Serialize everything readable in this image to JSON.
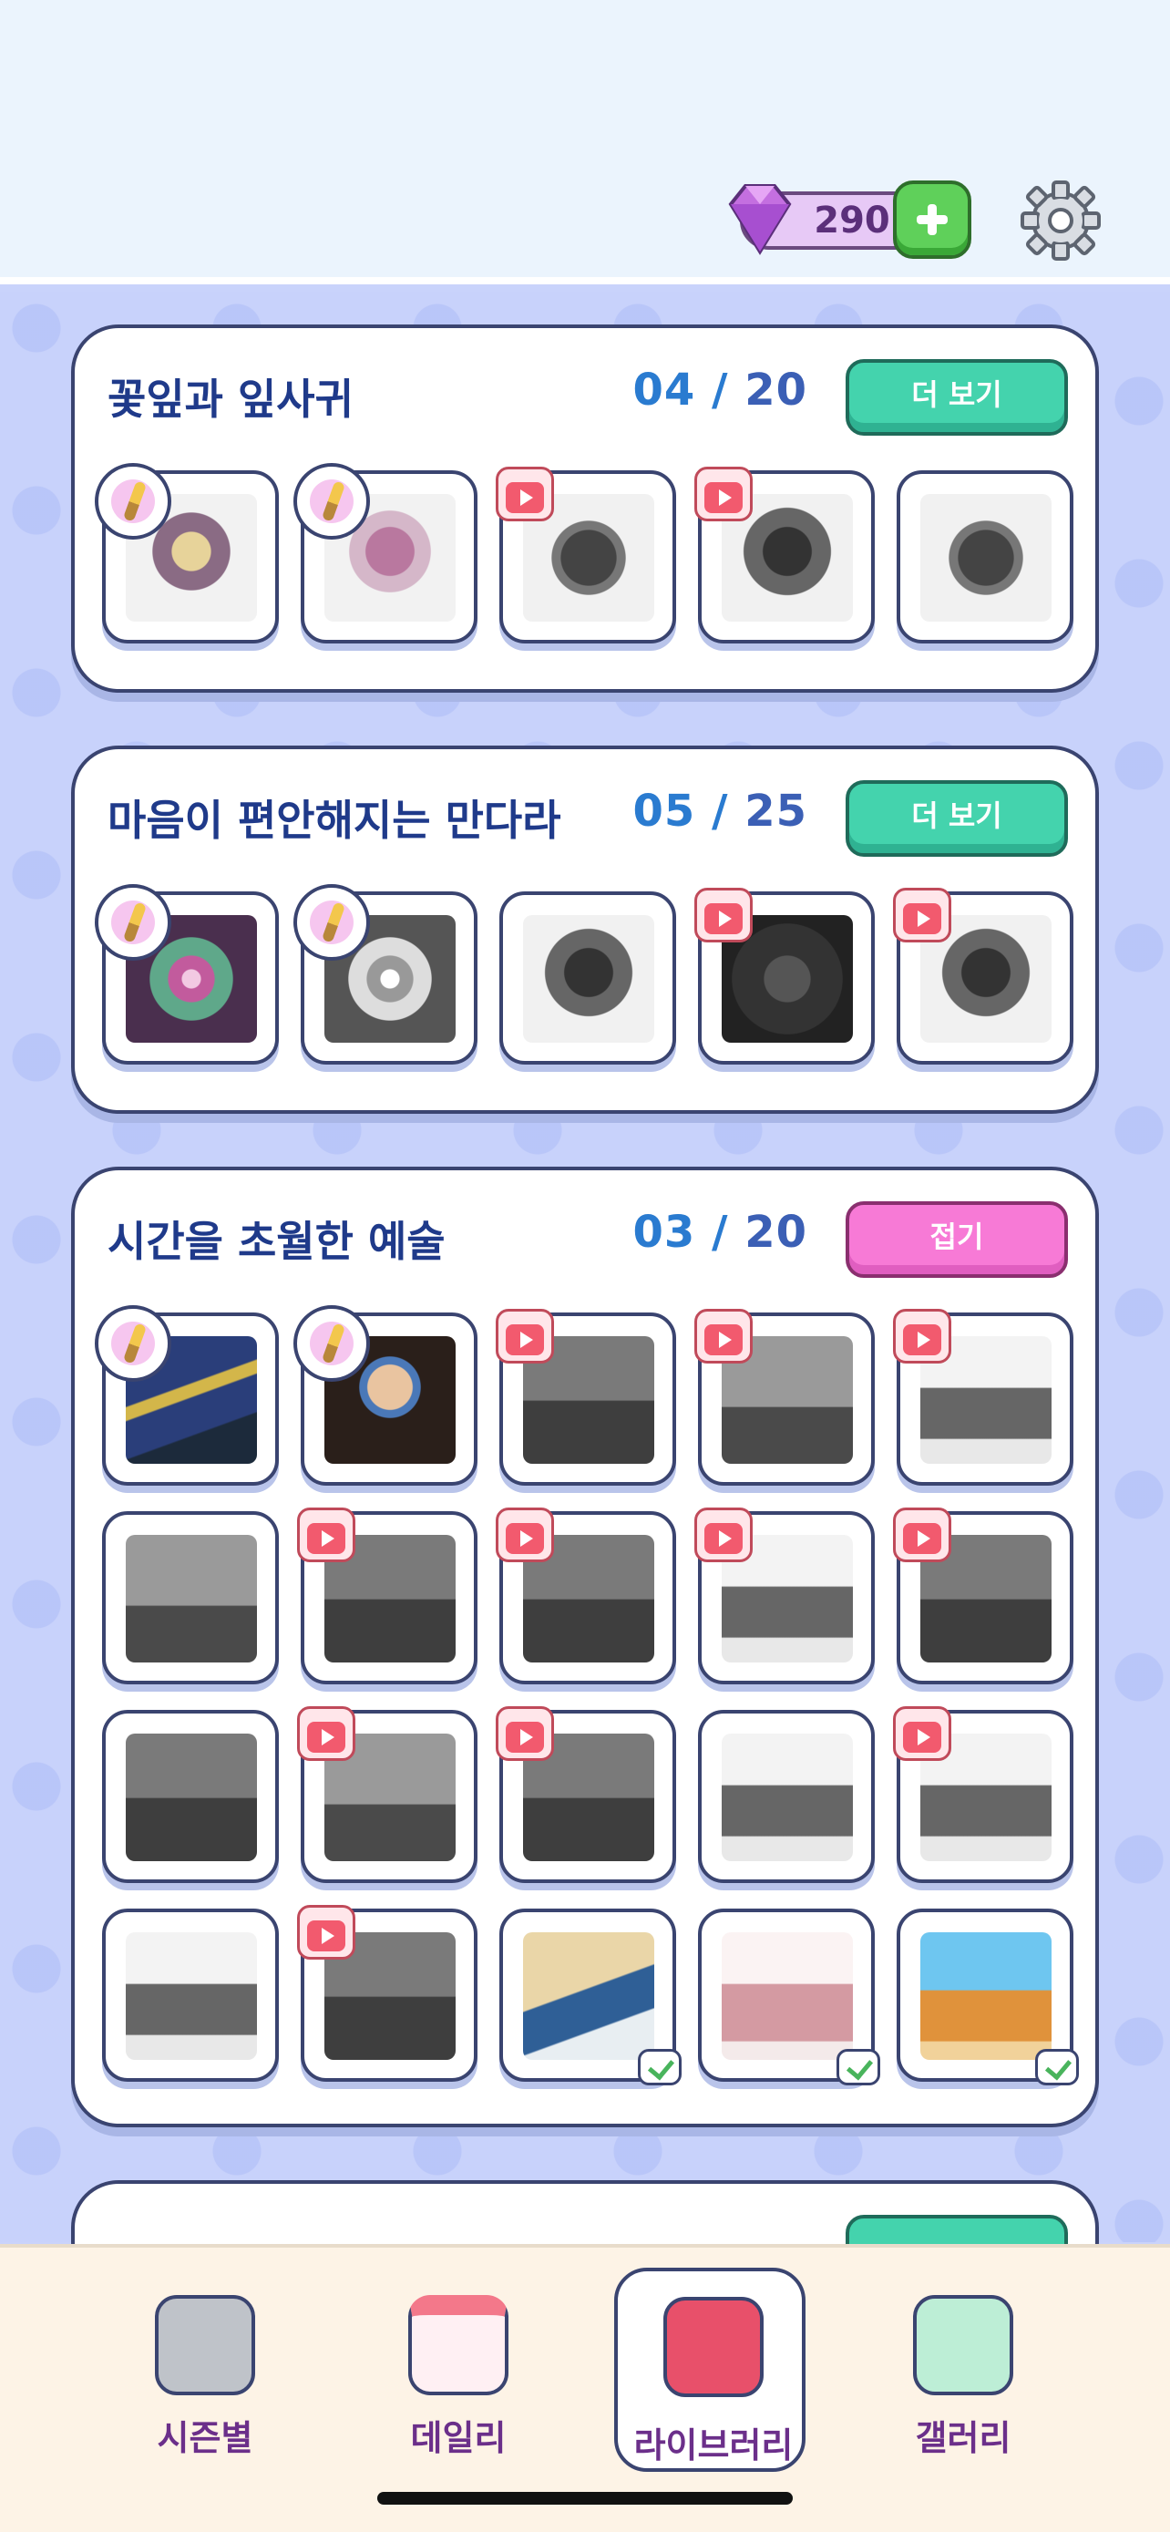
{
  "header": {
    "gem_count": "290",
    "gem_icon": "gem-icon",
    "add_icon": "plus-icon",
    "settings_icon": "gear-icon"
  },
  "sections": [
    {
      "title": "꽃잎과 잎사귀",
      "progress_current": "04",
      "progress_sep": " / ",
      "progress_total": "20",
      "button_label": "더 보기"
    },
    {
      "title": "마음이 편안해지는 만다라",
      "progress_current": "05",
      "progress_sep": " / ",
      "progress_total": "25",
      "button_label": "더 보기"
    },
    {
      "title": "시간을 초월한 예술",
      "progress_current": "03",
      "progress_sep": " / ",
      "progress_total": "20",
      "button_label": "접기"
    }
  ],
  "nav": [
    {
      "label": "시즌별",
      "icon": "season-icon"
    },
    {
      "label": "데일리",
      "icon": "calendar-star-icon"
    },
    {
      "label": "라이브러리",
      "icon": "book-icon"
    },
    {
      "label": "갤러리",
      "icon": "gallery-icon"
    }
  ],
  "colors": {
    "accent_green": "#44d3ad",
    "accent_pink": "#f77ad6",
    "title_blue": "#1f3a8a",
    "count_blue": "#2a7bd0",
    "nav_label": "#6b2f8a"
  }
}
